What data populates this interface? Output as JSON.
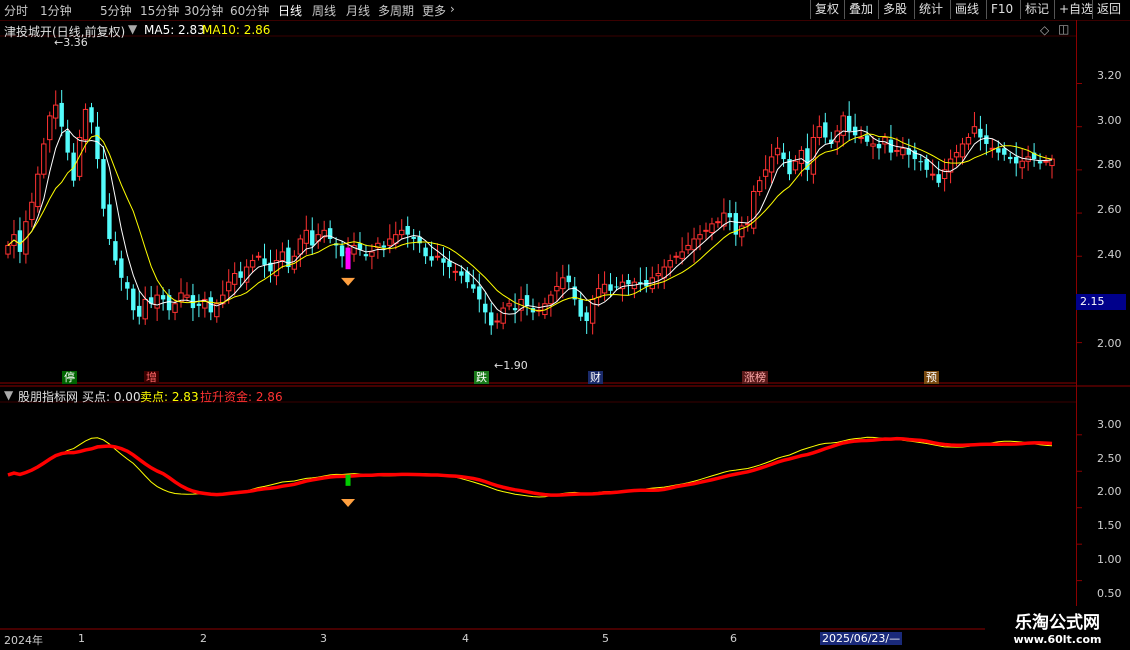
{
  "toolbar": {
    "periods": [
      "分时",
      "1分钟",
      "5分钟",
      "15分钟",
      "30分钟",
      "60分钟",
      "日线",
      "周线",
      "月线",
      "多周期",
      "更多"
    ],
    "active_period": "日线",
    "right_buttons": [
      "复权",
      "叠加",
      "多股",
      "统计",
      "画线",
      "F10",
      "标记",
      "+自选",
      "返回"
    ]
  },
  "main_header": {
    "stock": "津投城开(日线,前复权)",
    "ma5_label": "MA5: 2.83",
    "ma10_label": "MA10: 2.86"
  },
  "sub_header": {
    "indicator": "股朋指标网",
    "buy_label": "买点: 0.00",
    "sell_label": "卖点: 2.83",
    "fund_label": "拉升资金: 2.86"
  },
  "annotations": {
    "high_label": "3.36",
    "low_label": "1.90",
    "current_price": "2.15"
  },
  "event_tags": [
    "停",
    "增",
    "跌",
    "财",
    "涨榜",
    "预"
  ],
  "x_axis": {
    "labels": [
      "2024年",
      "1",
      "2",
      "3",
      "4",
      "5",
      "6"
    ],
    "cursor_date": "2025/06/23/—"
  },
  "watermark": {
    "title": "乐淘公式网",
    "url": "www.60lt.com"
  },
  "colors": {
    "up": "#ff3232",
    "down": "#54fcfc",
    "ma5": "#ffffff",
    "ma10": "#ffff00",
    "fund": "#ff0000",
    "axis": "#8b0000"
  },
  "chart_data": [
    {
      "type": "candlestick",
      "title": "津投城开(日线,前复权)",
      "ylim": [
        1.85,
        3.42
      ],
      "y_ticks": [
        2.0,
        2.2,
        2.4,
        2.6,
        2.8,
        3.0,
        3.2
      ],
      "series": [
        {
          "name": "close",
          "values": [
            2.45,
            2.5,
            2.42,
            2.56,
            2.65,
            2.78,
            2.92,
            3.05,
            3.1,
            3.0,
            2.88,
            2.75,
            2.95,
            3.08,
            3.02,
            2.85,
            2.62,
            2.48,
            2.38,
            2.3,
            2.25,
            2.15,
            2.12,
            2.2,
            2.18,
            2.22,
            2.2,
            2.15,
            2.18,
            2.23,
            2.22,
            2.16,
            2.17,
            2.2,
            2.14,
            2.18,
            2.22,
            2.28,
            2.32,
            2.3,
            2.35,
            2.38,
            2.4,
            2.36,
            2.33,
            2.38,
            2.42,
            2.35,
            2.4,
            2.48,
            2.52,
            2.45,
            2.5,
            2.52,
            2.48,
            2.45,
            2.4,
            2.42,
            2.45,
            2.43,
            2.4,
            2.42,
            2.46,
            2.44,
            2.48,
            2.5,
            2.52,
            2.5,
            2.48,
            2.46,
            2.4,
            2.38,
            2.4,
            2.37,
            2.35,
            2.33,
            2.31,
            2.28,
            2.25,
            2.2,
            2.14,
            2.08,
            2.1,
            2.16,
            2.18,
            2.15,
            2.2,
            2.17,
            2.14,
            2.15,
            2.18,
            2.22,
            2.26,
            2.3,
            2.28,
            2.2,
            2.12,
            2.1,
            2.2,
            2.25,
            2.27,
            2.24,
            2.26,
            2.28,
            2.27,
            2.28,
            2.27,
            2.26,
            2.3,
            2.32,
            2.35,
            2.38,
            2.4,
            2.42,
            2.45,
            2.48,
            2.5,
            2.52,
            2.55,
            2.56,
            2.6,
            2.58,
            2.5,
            2.54,
            2.55,
            2.7,
            2.75,
            2.8,
            2.86,
            2.9,
            2.85,
            2.78,
            2.84,
            2.89,
            2.8,
            2.95,
            3.0,
            2.95,
            2.92,
            2.98,
            3.05,
            2.98,
            2.96,
            2.95,
            2.93,
            2.92,
            2.9,
            2.95,
            2.88,
            2.89,
            2.9,
            2.87,
            2.85,
            2.84,
            2.8,
            2.78,
            2.74,
            2.8,
            2.85,
            2.88,
            2.92,
            2.95,
            3.0,
            2.95,
            2.92,
            2.9,
            2.88,
            2.87,
            2.85,
            2.83,
            2.84,
            2.86,
            2.85,
            2.83,
            2.84,
            2.85
          ]
        },
        {
          "name": "MA5",
          "values": [
            2.83
          ]
        },
        {
          "name": "MA10",
          "values": [
            2.86
          ]
        }
      ],
      "annotations": [
        {
          "text": "3.36",
          "value": 3.36
        },
        {
          "text": "1.90",
          "value": 1.9
        }
      ]
    },
    {
      "type": "line",
      "title": "股朋指标网",
      "ylim": [
        0.35,
        3.45
      ],
      "y_ticks": [
        0.5,
        1.0,
        1.5,
        2.0,
        2.5,
        3.0
      ],
      "series": [
        {
          "name": "买点",
          "values": [
            0.0
          ]
        },
        {
          "name": "卖点",
          "values": [
            2.83
          ]
        },
        {
          "name": "拉升资金",
          "values": [
            2.86
          ]
        }
      ]
    }
  ]
}
